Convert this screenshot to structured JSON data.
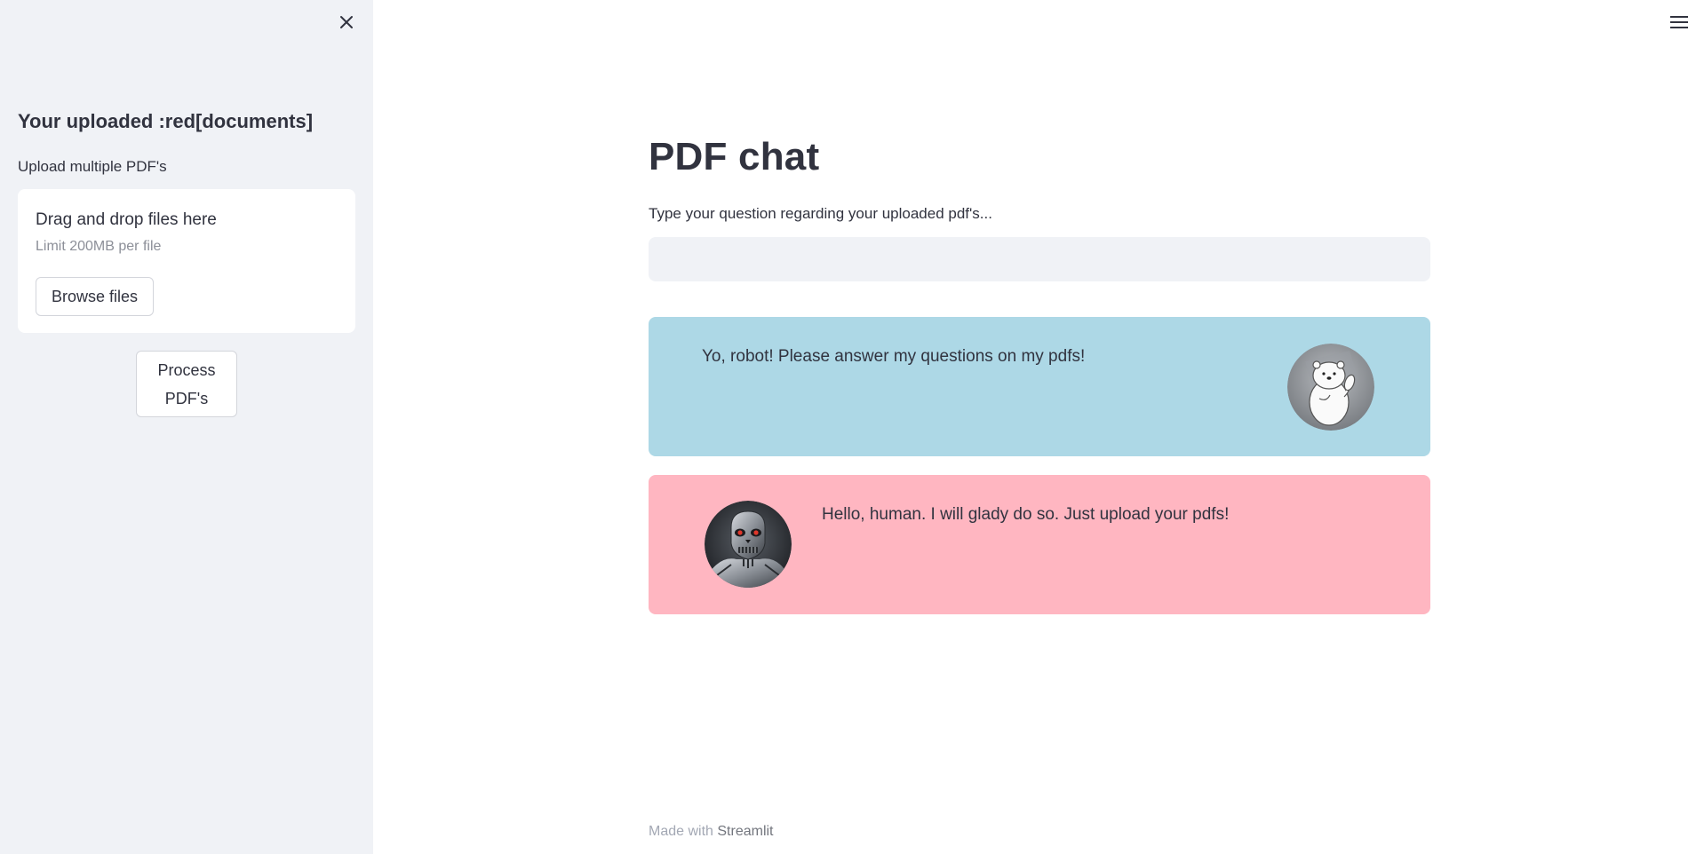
{
  "sidebar": {
    "close_icon": "close-icon",
    "heading": "Your uploaded :red[documents]",
    "upload_label": "Upload multiple PDF's",
    "dropzone": {
      "title": "Drag and drop files here",
      "limit": "Limit 200MB per file",
      "browse_label": "Browse files"
    },
    "process_label": "Process PDF's"
  },
  "main": {
    "menu_icon": "hamburger-menu-icon",
    "title": "PDF chat",
    "question_label": "Type your question regarding your uploaded pdf's...",
    "question_value": "",
    "messages": [
      {
        "role": "user",
        "text": "Yo, robot! Please answer my questions on my pdfs!",
        "avatar": "polar-bear-avatar",
        "color": "#add8e6"
      },
      {
        "role": "bot",
        "text": "Hello, human. I will glady do so. Just upload your pdfs!",
        "avatar": "robot-skull-avatar",
        "color": "#ffb6c1"
      }
    ]
  },
  "footer": {
    "prefix": "Made with",
    "brand": "Streamlit"
  }
}
